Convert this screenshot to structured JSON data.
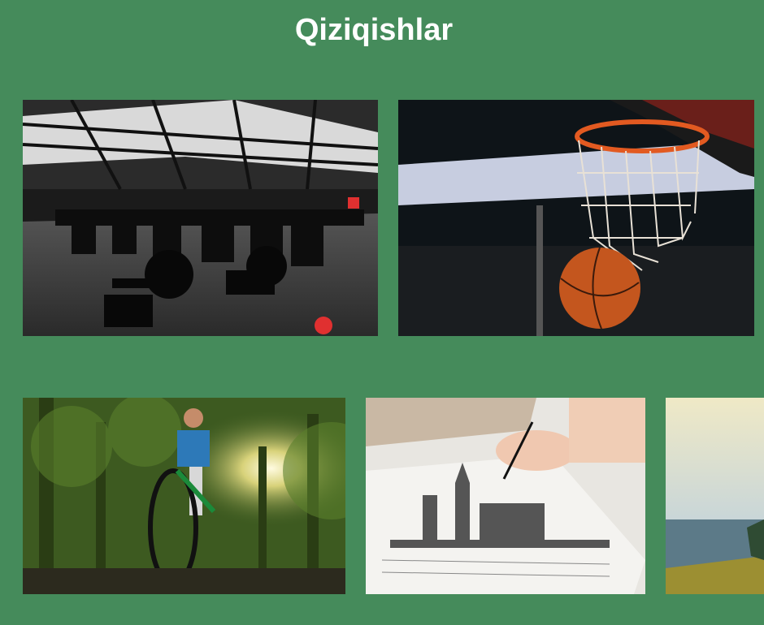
{
  "page": {
    "title": "Qiziqishlar"
  },
  "gallery": {
    "row1": [
      {
        "id": "gym",
        "icon": "gym-photo"
      },
      {
        "id": "basketball",
        "icon": "basketball-photo"
      }
    ],
    "row2": [
      {
        "id": "cycling",
        "icon": "cycling-photo"
      },
      {
        "id": "drawing",
        "icon": "drawing-photo"
      },
      {
        "id": "sea",
        "icon": "seaside-photo"
      }
    ]
  },
  "colors": {
    "background": "#458b5b",
    "title": "#ffffff"
  }
}
